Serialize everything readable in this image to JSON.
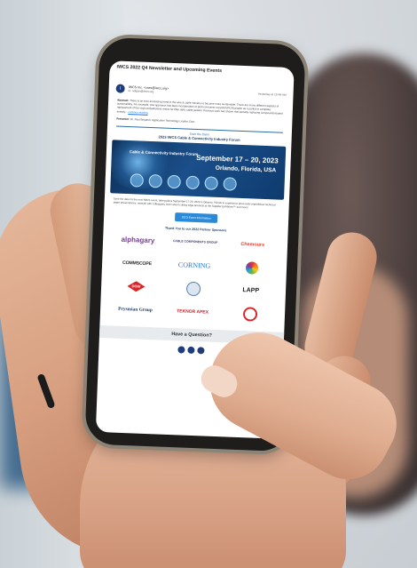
{
  "email": {
    "subject": "IWCS 2022 Q4 Newsletter and Upcoming Events",
    "avatar_letter": "I",
    "sender": "IWCS Inc. <cses@iwcs.org>",
    "to": "to: sdigan@iwcs.org",
    "date": "Yesterday at 10:48 AM"
  },
  "article": {
    "abstract_label": "Abstract:",
    "abstract_text": "There is an ever-increasing trend in the wire & cable industry to become more sustainable. There are many different aspects of sustainability. For example, one approach has been incorporation of post-consumer recycled (PCR) plastic as a partial or complete replacement of the virgin polyethylene resins for fiber optic cable jackets. Previous work has shown that partially replacing compounds-based entirely...",
    "continue_link": "continue reading",
    "presenter_label": "Presenter:",
    "presenter_text": "Dr. Paul Brigandi, Application Technology Leader, Dow"
  },
  "event": {
    "save_the_date": "Save the Date!",
    "forum_title": "2023 IWCS Cable & Connectivity Industry Forum",
    "banner_left": "Cable & Connectivity Industry Forum",
    "banner_dates": "September 17 – 20, 2023",
    "banner_place": "Orlando, Florida, USA",
    "announce": "Save the date for the next IWCS event, taking place September 17-20, 2023 in Orlando, Florida to experience previously unpublished technical paper presentations, network with colleagues, learn about cutting edge products at the Supplier Exhibitors™ and more!",
    "cta": "2023 Event Information"
  },
  "sponsors": {
    "title": "Thank You to our 2022 Partner Sponsors",
    "names": [
      "alphagary",
      "CABLE COMPONENTS GROUP",
      "Chemours",
      "COMMSCOPE",
      "CORNING",
      "DOW",
      "LAPP",
      "Prysmian Group",
      "TEKNOR APEX"
    ]
  },
  "footer": {
    "question": "Have a Question?"
  }
}
